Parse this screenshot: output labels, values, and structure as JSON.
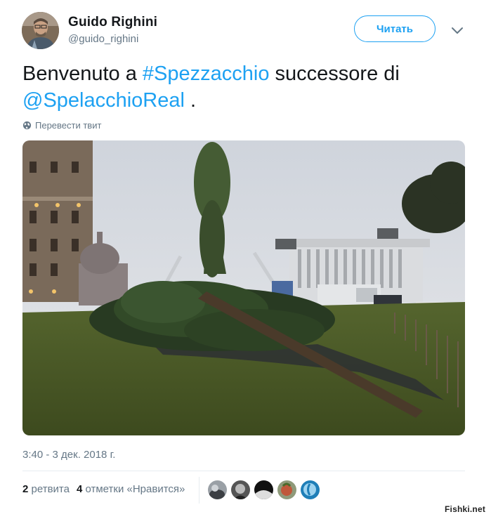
{
  "author": {
    "name": "Guido Righini",
    "handle": "@guido_righini",
    "follow_label": "Читать"
  },
  "tweet": {
    "text_before": "Benvenuto a ",
    "hashtag": "#Spezzacchio",
    "text_middle": " successore di ",
    "mention": "@SpelacchioReal",
    "text_after": " .",
    "translate_label": "Перевести твит",
    "timestamp": "3:40 - 3 дек. 2018 г."
  },
  "stats": {
    "retweets_count": "2",
    "retweets_label": "ретвита",
    "likes_count": "4",
    "likes_label": "отметки «Нравится»"
  },
  "watermark": "Fishki.net",
  "icons": {
    "caret": "chevron-down-icon",
    "translate": "globe-icon"
  },
  "colors": {
    "accent": "#1da1f2",
    "secondary_text": "#657786",
    "primary_text": "#14171a",
    "divider": "#e6ecf0"
  }
}
